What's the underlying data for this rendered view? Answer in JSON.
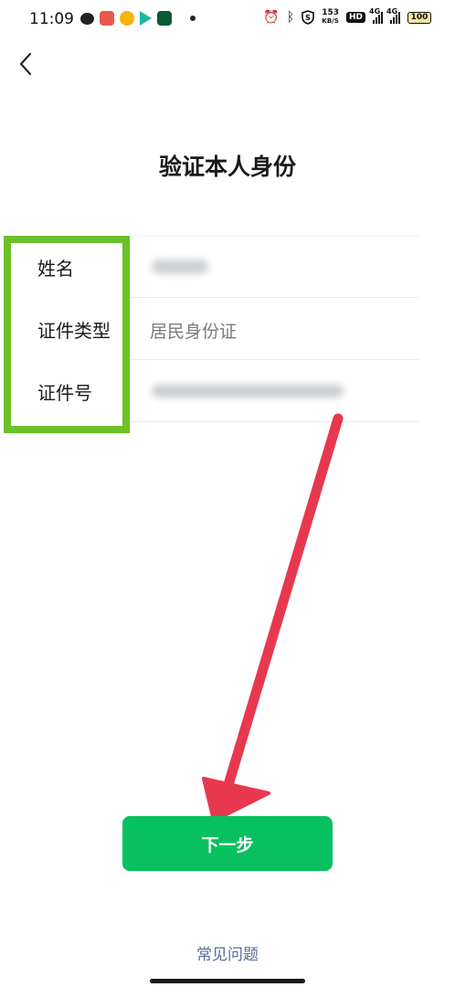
{
  "status_bar": {
    "time": "11:09",
    "net_speed_top": "153",
    "net_speed_bottom": "KB/S",
    "hd": "HD",
    "signal1_label": "4G",
    "signal2_label": "4G",
    "battery": "100",
    "icons": [
      "wechat-icon",
      "douyin-icon",
      "weibo-icon",
      "video-icon",
      "oppo-icon",
      "alarm-icon",
      "bluetooth-icon",
      "shield-s-icon"
    ]
  },
  "header": {
    "title": "验证本人身份"
  },
  "form": {
    "rows": [
      {
        "label": "姓名",
        "value": ""
      },
      {
        "label": "证件类型",
        "value": "居民身份证"
      },
      {
        "label": "证件号",
        "value": ""
      }
    ]
  },
  "actions": {
    "next_label": "下一步",
    "faq_label": "常见问题"
  },
  "colors": {
    "primary": "#07c160",
    "highlight": "#6cc12a",
    "arrow": "#e8384f",
    "link": "#576b95"
  }
}
